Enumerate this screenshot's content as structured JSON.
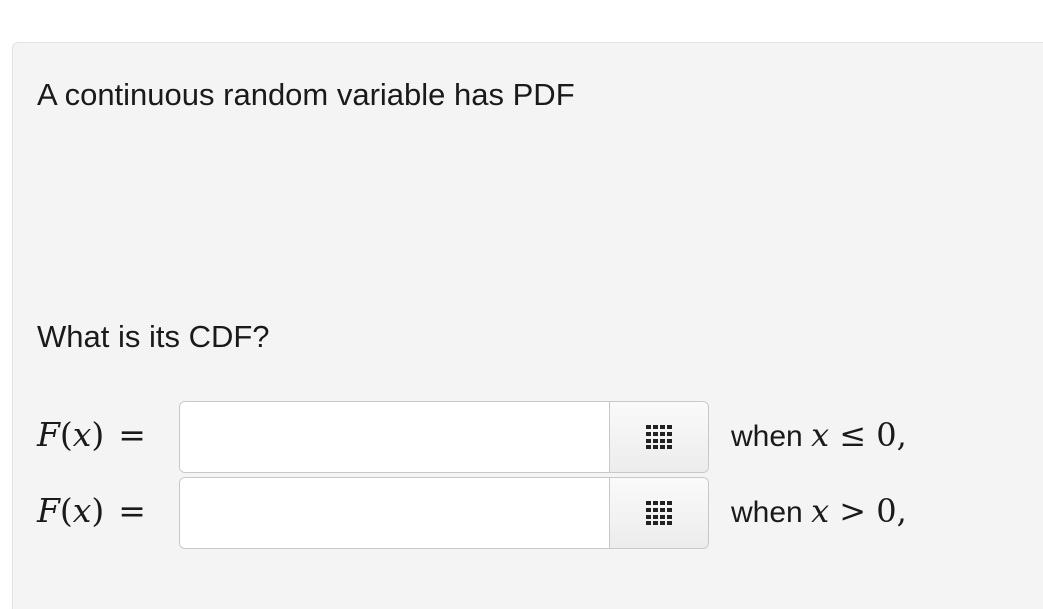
{
  "question": {
    "prompt": "A continuous random variable has PDF",
    "subprompt": "What is its CDF?"
  },
  "answers": [
    {
      "lhs_func": "F",
      "lhs_var": "x",
      "input_value": "",
      "condition_prefix": "when",
      "condition_var": "x",
      "condition_rel": "≤",
      "condition_rhs": "0,",
      "palette_icon": "grid-icon"
    },
    {
      "lhs_func": "F",
      "lhs_var": "x",
      "input_value": "",
      "condition_prefix": "when",
      "condition_var": "x",
      "condition_rel": ">",
      "condition_rhs": "0,",
      "palette_icon": "grid-icon"
    }
  ]
}
